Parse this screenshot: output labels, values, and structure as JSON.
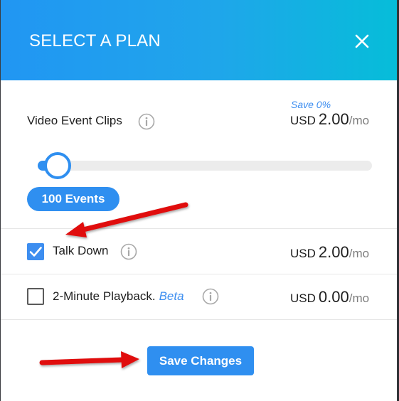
{
  "modal": {
    "title": "SELECT A PLAN"
  },
  "video_clips": {
    "label": "Video Event Clips",
    "save_text": "Save 0%",
    "currency": "USD",
    "amount": "2.00",
    "period": "/mo",
    "slider_fraction": 0.06,
    "events_label": "100 Events"
  },
  "talk_down": {
    "label": "Talk Down",
    "checked": true,
    "currency": "USD",
    "amount": "2.00",
    "period": "/mo"
  },
  "playback": {
    "label": "2-Minute Playback.",
    "badge": "Beta",
    "checked": false,
    "currency": "USD",
    "amount": "0.00",
    "period": "/mo"
  },
  "footer": {
    "save_button": "Save Changes"
  },
  "colors": {
    "accent": "#2f8ff0",
    "header_start": "#2196f3",
    "header_end": "#06bdd9",
    "annotation": "#e01010"
  },
  "icons": [
    "close-icon",
    "info-icon",
    "checkmark-icon",
    "annotation-arrow"
  ]
}
